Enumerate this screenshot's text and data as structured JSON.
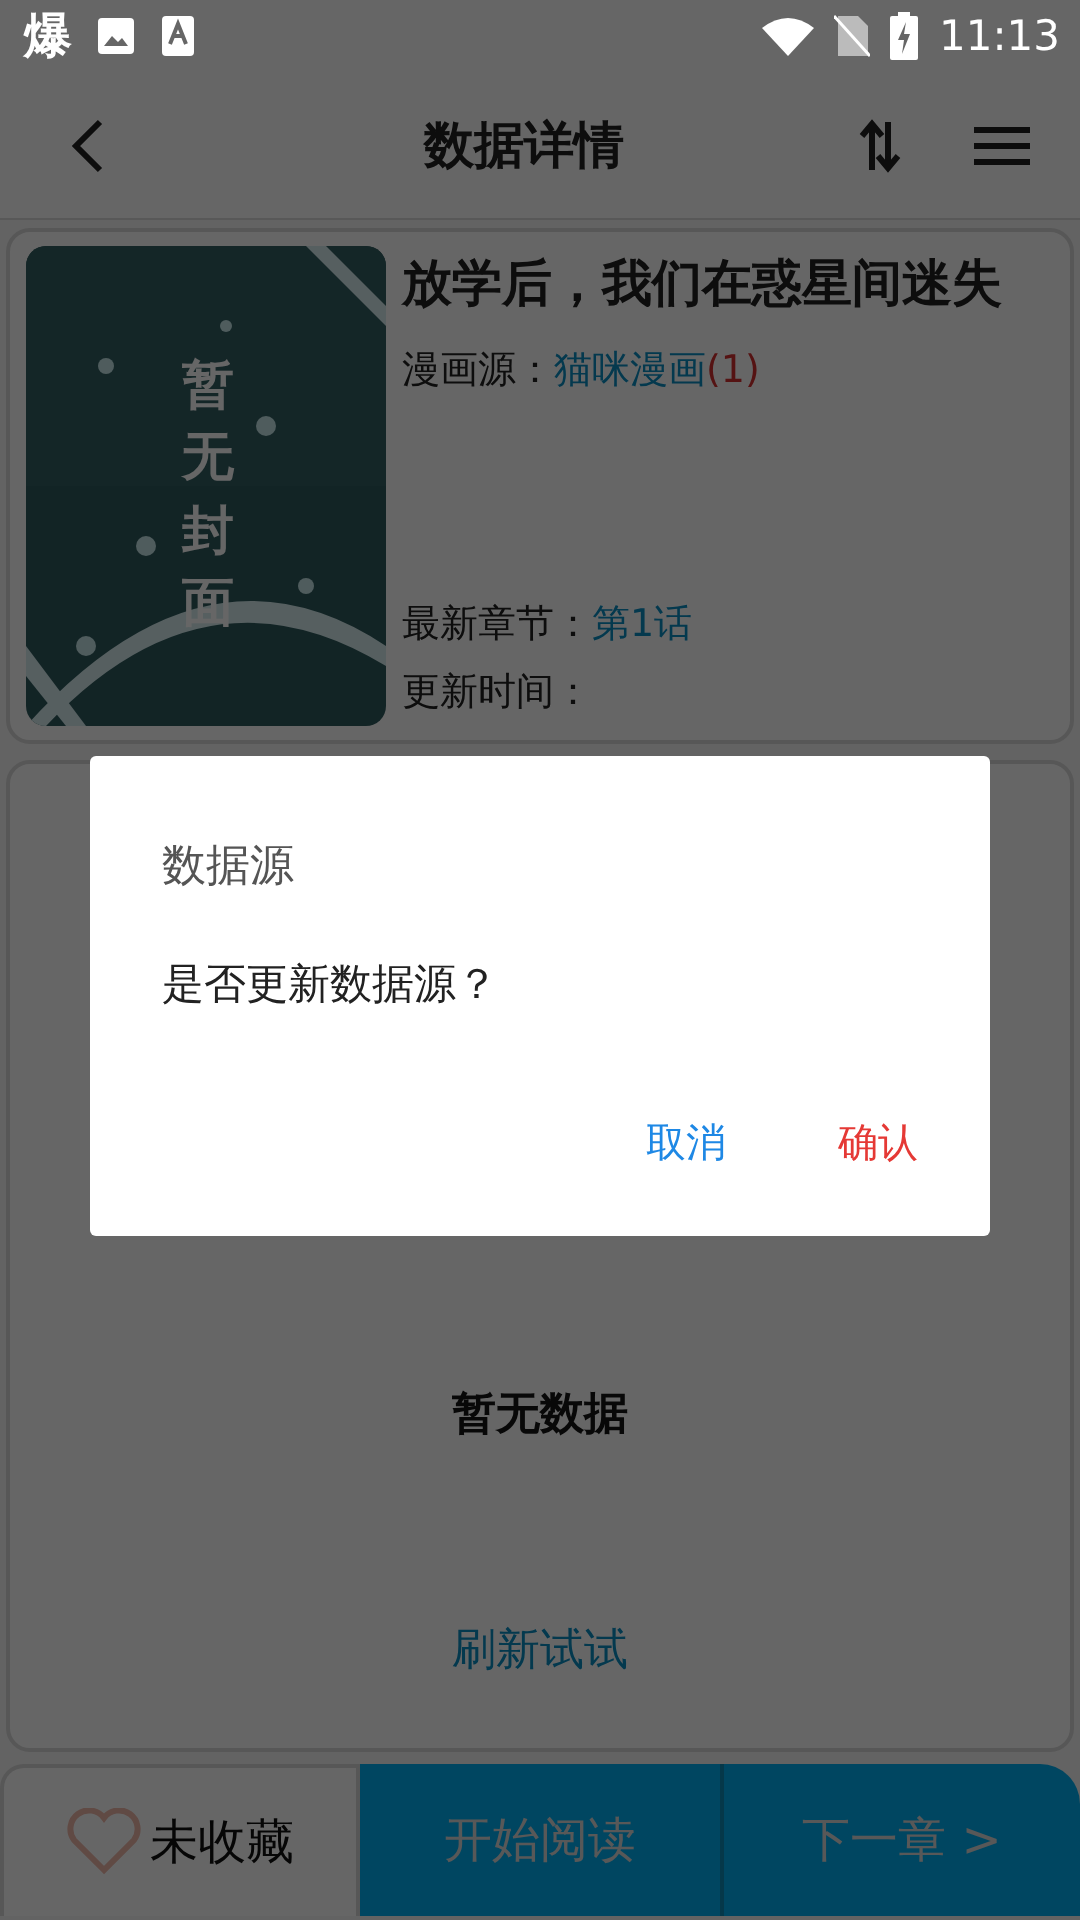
{
  "status_bar": {
    "app_glyph": "爆",
    "time": "11:13"
  },
  "toolbar": {
    "title": "数据详情"
  },
  "comic": {
    "title": "放学后，我们在惑星间迷失",
    "cover_text": "暂无封面",
    "source_label": "漫画源：",
    "source": "猫咪漫画",
    "source_count": "(1)",
    "latest_label": "最新章节：",
    "latest": "第1话",
    "update_label": "更新时间："
  },
  "chapters": {
    "empty_text": "暂无数据",
    "retry": "刷新试试"
  },
  "bottom_bar": {
    "favorite": {
      "label": "未收藏",
      "favorited": false
    },
    "start": "开始阅读",
    "next": "下一章 >"
  },
  "dialog": {
    "title": "数据源",
    "message": "是否更新数据源？",
    "buttons": [
      {
        "label": "取消",
        "kind": "cancel"
      },
      {
        "label": "确认",
        "kind": "confirm"
      }
    ]
  }
}
